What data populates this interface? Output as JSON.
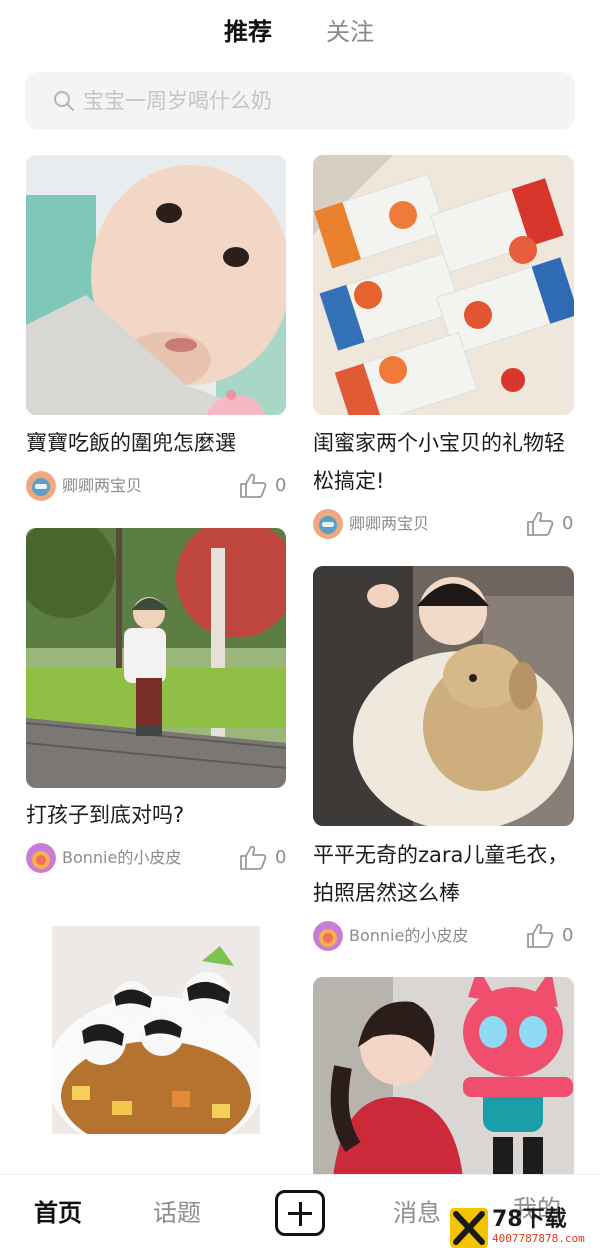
{
  "top_tabs": {
    "recommend": "推荐",
    "follow": "关注"
  },
  "search": {
    "placeholder": "宝宝一周岁喝什么奶"
  },
  "cards": [
    {
      "title": "寶寶吃飯的圍兜怎麼選",
      "author": "卿卿两宝贝",
      "likes": "0"
    },
    {
      "title": "闺蜜家两个小宝贝的礼物轻松搞定!",
      "author": "卿卿两宝贝",
      "likes": "0"
    },
    {
      "title": "打孩子到底对吗?",
      "author": "Bonnie的小皮皮",
      "likes": "0"
    },
    {
      "title": "平平无奇的zara儿童毛衣，拍照居然这么棒",
      "author": "Bonnie的小皮皮",
      "likes": "0"
    }
  ],
  "bottom_nav": {
    "home": "首页",
    "topics": "话题",
    "messages": "消息",
    "me": "我的"
  },
  "watermark": {
    "brand": "78下载",
    "url": "4007787878.com"
  },
  "colors": {
    "accent": "#111111",
    "muted": "#8c8c8c",
    "search_bg": "#f4f4f4"
  }
}
